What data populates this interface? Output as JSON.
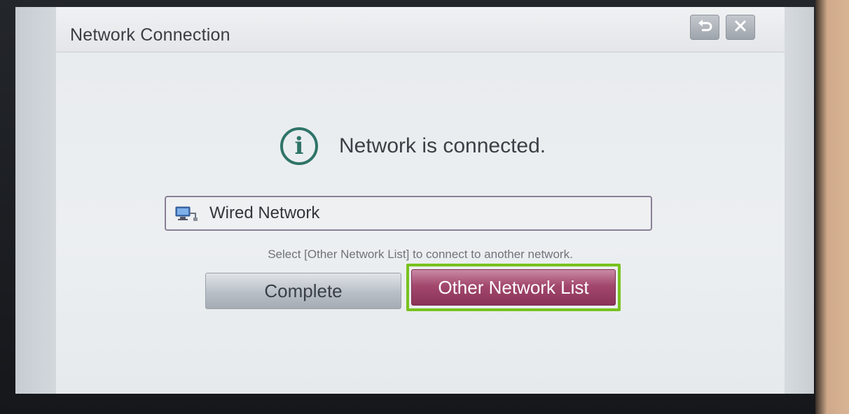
{
  "dialog": {
    "title": "Network Connection",
    "back_icon": "back-arrow-icon",
    "close_icon": "close-icon"
  },
  "status": {
    "icon": "info-icon",
    "message": "Network is connected."
  },
  "network": {
    "icon": "wired-network-icon",
    "label": "Wired Network"
  },
  "hint_text": "Select [Other Network List] to connect to another network.",
  "buttons": {
    "complete_label": "Complete",
    "other_network_label": "Other Network List"
  },
  "colors": {
    "focus_ring": "#78c21e",
    "primary_button": "#a2476d",
    "info_icon": "#2f7468"
  }
}
